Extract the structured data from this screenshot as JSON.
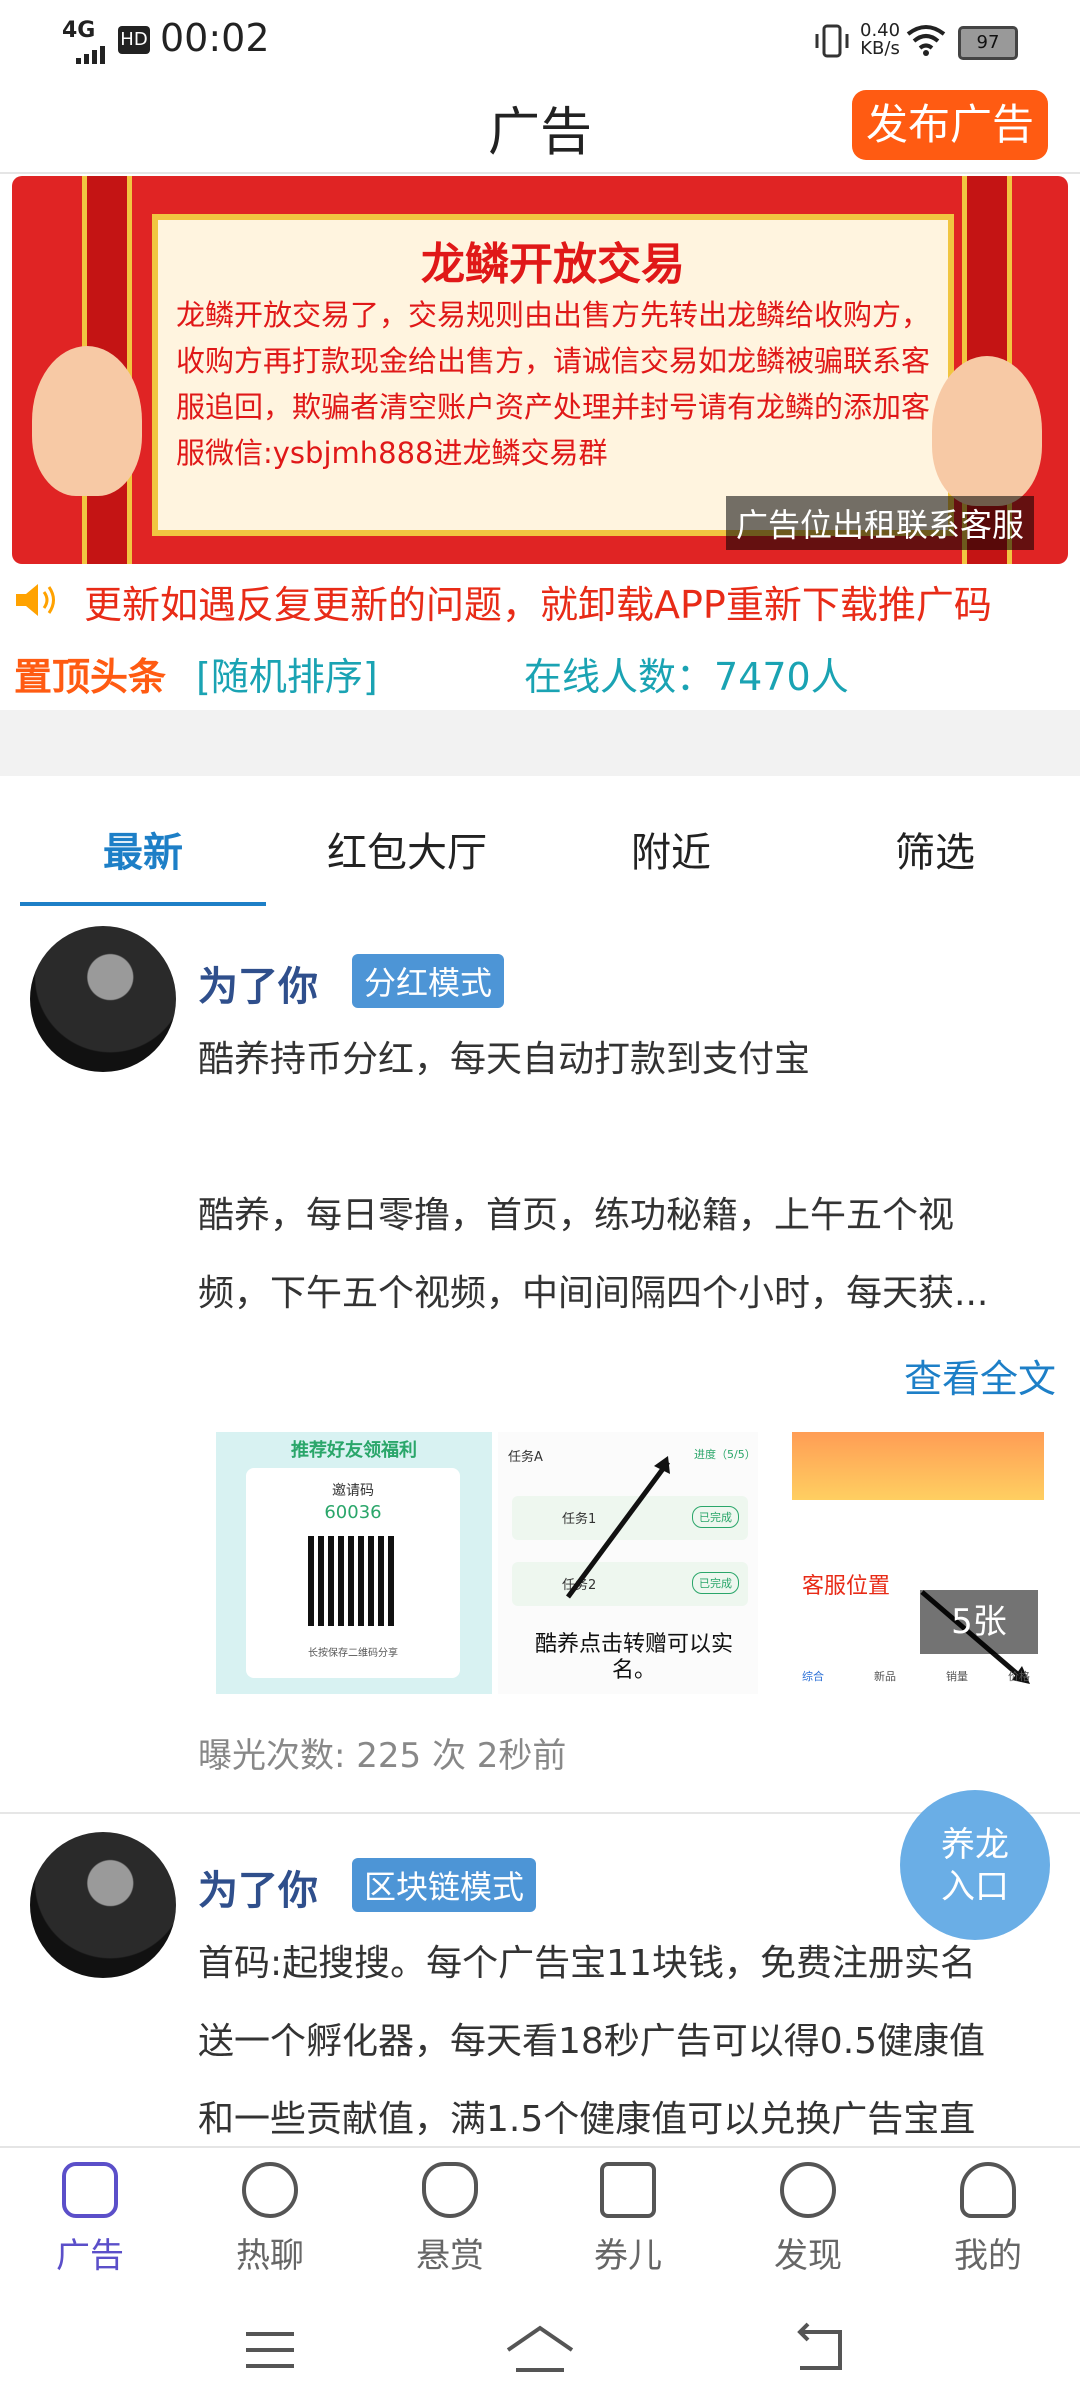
{
  "status": {
    "net": "4G",
    "hd": "HD",
    "time": "00:02",
    "speed_value": "0.40",
    "speed_unit": "KB/s",
    "battery": "97"
  },
  "header": {
    "title": "广告",
    "publish": "发布广告"
  },
  "banner": {
    "title": "龙鳞开放交易",
    "text": "龙鳞开放交易了，交易规则由出售方先转出龙鳞给收购方，收购方再打款现金给出售方，请诚信交易如龙鳞被骗联系客服追回，欺骗者清空账户资产处理并封号请有龙鳞的添加客服微信:ysbjmh888进龙鳞交易群",
    "tag": "广告位出租联系客服"
  },
  "marquee": {
    "text": "更新如遇反复更新的问题，就卸载APP重新下载推广码"
  },
  "topline": {
    "label": "置顶头条",
    "random": "[随机排序]",
    "online": "在线人数：7470人"
  },
  "tabs": [
    "最新",
    "红包大厅",
    "附近",
    "筛选"
  ],
  "posts": [
    {
      "user": "为了你",
      "badge": "分红模式",
      "line1": "酷养持币分红，每天自动打款到支付宝",
      "line2": "酷养，每日零撸，首页，练功秘籍，上午五个视",
      "line3": "频，下午五个视频，中间间隔四个小时，每天获...",
      "readmore": "查看全文",
      "thumb1": {
        "title": "推荐好友领福利",
        "code_label": "邀请码",
        "code": "60036",
        "foot": "长按保存二维码分享"
      },
      "thumb2": {
        "task_a": "任务A",
        "progress": "进度（5/5）",
        "tasks": [
          "任务1",
          "任务2"
        ],
        "done": "已完成",
        "caption": "酷养点击转赠可以实名。"
      },
      "thumb3": {
        "caption": "客服位置",
        "tabs": [
          "综合",
          "新品",
          "销量",
          "价格"
        ]
      },
      "count": "5张",
      "meta": "曝光次数: 225 次  2秒前"
    },
    {
      "user": "为了你",
      "badge": "区块链模式",
      "line1": "首码:起搜搜。每个广告宝11块钱，免费注册实名",
      "line2": "送一个孵化器，每天看18秒广告可以得0.5健康值",
      "line3": "和一些贡献值，满1.5个健康值可以兑换广告宝直"
    }
  ],
  "float_button": {
    "line1": "养龙",
    "line2": "入口"
  },
  "bottom_nav": [
    "广告",
    "热聊",
    "悬赏",
    "券儿",
    "发现",
    "我的"
  ],
  "colors": {
    "accent": "#1d7fc7",
    "publish": "#ff5b12",
    "nav_active": "#5b4fc9"
  }
}
